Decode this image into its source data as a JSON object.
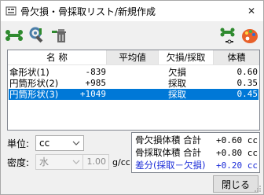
{
  "window": {
    "title": "骨欠損・骨採取リスト/新規作成",
    "close_glyph": "✕"
  },
  "toolbar": {
    "buttons": [
      {
        "name": "bone-tool-icon",
        "color": "#2f8a2f"
      },
      {
        "name": "settings-tool-icon",
        "color": "#4b7ea8"
      },
      {
        "name": "delete-trash-icon",
        "color": "#2f8a2f"
      },
      {
        "name": "bone-measure-icon",
        "color": "#2f8a2f"
      },
      {
        "name": "palette-icon",
        "color": "#e8602a"
      }
    ]
  },
  "list": {
    "columns": [
      "名 称",
      "平均値",
      "欠損/採取",
      "体積"
    ],
    "rows": [
      {
        "name": "傘形状(1)",
        "average": "-839",
        "type": "欠損",
        "volume": "0.60",
        "selected": false
      },
      {
        "name": "円筒形状(2)",
        "average": "+985",
        "type": "採取",
        "volume": "0.35",
        "selected": false
      },
      {
        "name": "円筒形状(3)",
        "average": "+1049",
        "type": "採取",
        "volume": "0.45",
        "selected": true
      }
    ]
  },
  "settings": {
    "unit_label": "単位:",
    "unit_value": "cc",
    "density_label": "密度:",
    "density_value": "水",
    "density_number": "1.00",
    "density_unit": "g/cc"
  },
  "summary": {
    "rows": [
      {
        "label": "骨欠損体積 合計",
        "value": "+0.60 cc"
      },
      {
        "label": "骨採取体積 合計",
        "value": "+0.80 cc"
      },
      {
        "label": "差分(採取－欠損)",
        "value": "+0.20 cc"
      }
    ],
    "diff_color": "#1a2bd8"
  },
  "footer": {
    "close_label": "閉じる"
  },
  "colors": {
    "selection": "#0078d7",
    "window_bg": "#f0f0f0"
  }
}
